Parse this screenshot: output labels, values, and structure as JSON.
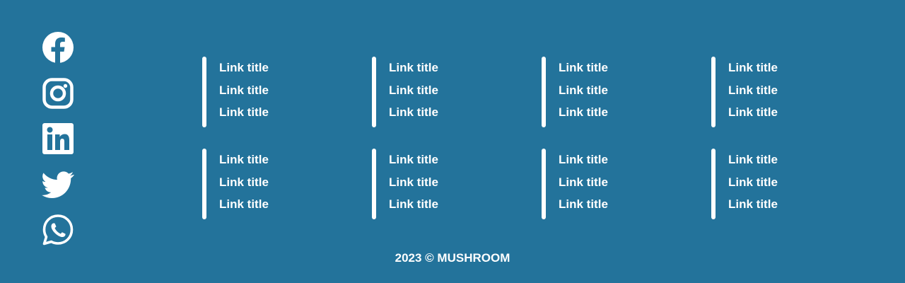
{
  "colors": {
    "background": "#23739b",
    "foreground": "#ffffff"
  },
  "social": [
    {
      "name": "facebook-icon"
    },
    {
      "name": "instagram-icon"
    },
    {
      "name": "linkedin-icon"
    },
    {
      "name": "twitter-icon"
    },
    {
      "name": "whatsapp-icon"
    }
  ],
  "links": {
    "rows": [
      [
        [
          "Link title",
          "Link title",
          "Link title"
        ],
        [
          "Link title",
          "Link title",
          "Link title"
        ],
        [
          "Link title",
          "Link title",
          "Link title"
        ],
        [
          "Link title",
          "Link title",
          "Link title"
        ]
      ],
      [
        [
          "Link title",
          "Link title",
          "Link title"
        ],
        [
          "Link title",
          "Link title",
          "Link title"
        ],
        [
          "Link title",
          "Link title",
          "Link title"
        ],
        [
          "Link title",
          "Link title",
          "Link title"
        ]
      ]
    ]
  },
  "footer": {
    "copyright": "2023 © MUSHROOM"
  }
}
